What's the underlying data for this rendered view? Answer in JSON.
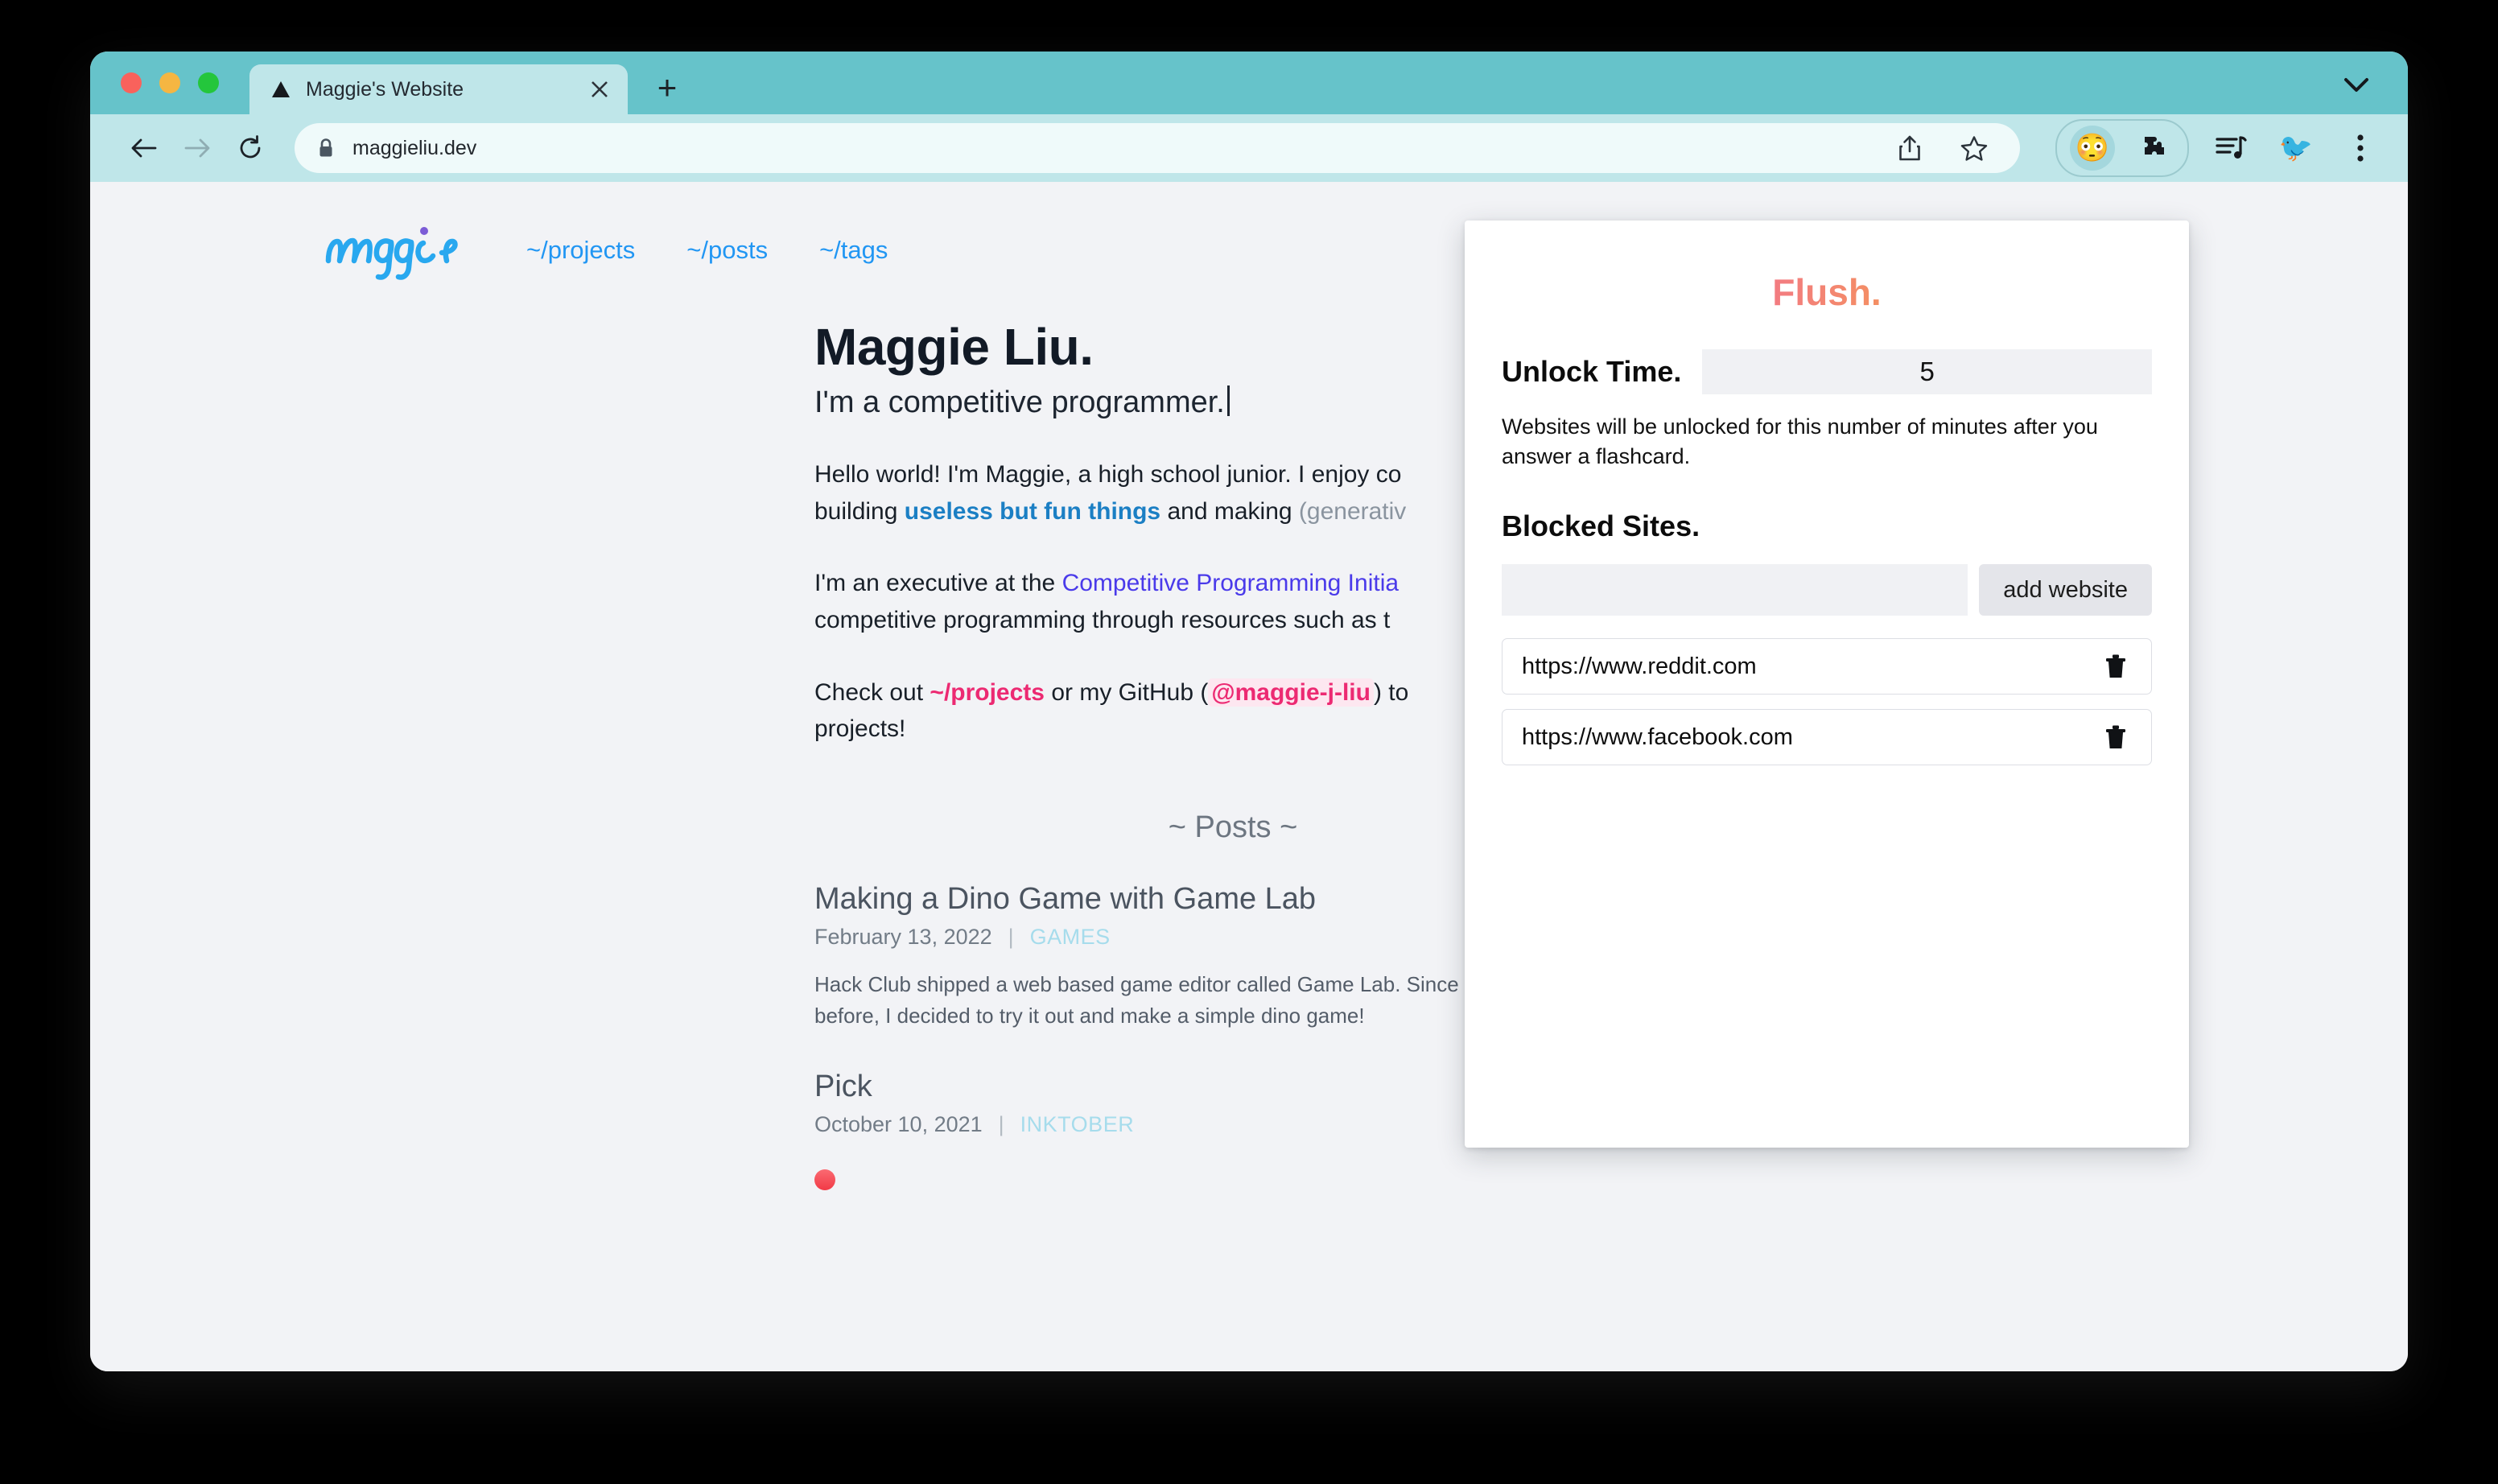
{
  "browser": {
    "tab": {
      "title": "Maggie's Website",
      "favicon_icon": "triangle-favicon",
      "close_icon": "close-icon"
    },
    "new_tab_label": "+",
    "tabstrip_chevron_icon": "chevron-down-icon",
    "toolbar": {
      "back_icon": "back-arrow-icon",
      "forward_icon": "forward-arrow-icon",
      "reload_icon": "reload-icon",
      "lock_icon": "lock-icon",
      "url": "maggieliu.dev",
      "share_icon": "share-icon",
      "bookmark_icon": "star-icon",
      "extension_active_icon": "flushed-face-icon",
      "extension_active_glyph": "😳",
      "puzzle_icon": "puzzle-piece-icon",
      "music_icon": "music-playlist-icon",
      "avatar_icon": "birds-avatar-icon",
      "avatar_glyph": "🐦",
      "menu_icon": "three-dot-menu-icon"
    },
    "window_controls": {
      "close": "close-window-button",
      "minimize": "minimize-window-button",
      "maximize": "maximize-window-button"
    }
  },
  "site": {
    "logo_text": "maggie",
    "nav": [
      {
        "label": "~/projects"
      },
      {
        "label": "~/posts"
      },
      {
        "label": "~/tags"
      }
    ],
    "hero": {
      "title": "Maggie Liu.",
      "subtitle": "I'm a competitive programmer."
    },
    "paragraphs": [
      {
        "parts": [
          {
            "text": "Hello world! I'm Maggie, a high school junior. I enjoy co",
            "style": "plain"
          },
          {
            "text": "building ",
            "style": "plain",
            "newline": true
          },
          {
            "text": "useless but fun things",
            "style": "blue"
          },
          {
            "text": " and making ",
            "style": "plain"
          },
          {
            "text": "(generativ",
            "style": "grey"
          }
        ]
      },
      {
        "parts": [
          {
            "text": "I'm an executive at the ",
            "style": "plain"
          },
          {
            "text": "Competitive Programming Initia",
            "style": "purple"
          },
          {
            "text": "competitive programming through resources such as t",
            "style": "plain",
            "newline": true
          }
        ]
      },
      {
        "parts": [
          {
            "text": "Check out ",
            "style": "plain"
          },
          {
            "text": "~/projects",
            "style": "pink"
          },
          {
            "text": " or my GitHub (",
            "style": "plain"
          },
          {
            "text": "@maggie-j-liu",
            "style": "code-pink"
          },
          {
            "text": ") to",
            "style": "plain"
          },
          {
            "text": "projects!",
            "style": "plain",
            "newline": true
          }
        ]
      }
    ],
    "posts_heading": "~ Posts ~",
    "posts": [
      {
        "title": "Making a Dino Game with Game Lab",
        "date": "February 13, 2022",
        "separator": "|",
        "tag": "GAMES",
        "excerpt_line1": "Hack Club shipped a web based game editor called Game Lab. Since I've never made a game",
        "excerpt_line2": "before, I decided to try it out and make a simple dino game!"
      },
      {
        "title": "Pick",
        "date": "October 10, 2021",
        "separator": "|",
        "tag": "INKTOBER",
        "excerpt_line1": "",
        "excerpt_line2": ""
      }
    ]
  },
  "popup": {
    "title": "Flush.",
    "unlock_time_label": "Unlock Time.",
    "unlock_time_value": "5",
    "unlock_time_placeholder": "",
    "help_text": "Websites will be unlocked for this number of minutes after you answer a flashcard.",
    "blocked_sites_label": "Blocked Sites.",
    "add_input_value": "",
    "add_input_placeholder": "",
    "add_button_label": "add website",
    "delete_icon": "trash-icon",
    "blocked_sites": [
      {
        "url": "https://www.reddit.com"
      },
      {
        "url": "https://www.facebook.com"
      }
    ]
  },
  "colors": {
    "chrome_teal": "#66c3ca",
    "toolbar_teal": "#bfe6e9",
    "page_bg": "#f2f3f6",
    "accent_blue": "#2196f3",
    "accent_pink": "#ec2a72",
    "accent_purple": "#4a3aea",
    "flush_gradient_start": "#f2728f",
    "flush_gradient_end": "#f6ab3e"
  }
}
